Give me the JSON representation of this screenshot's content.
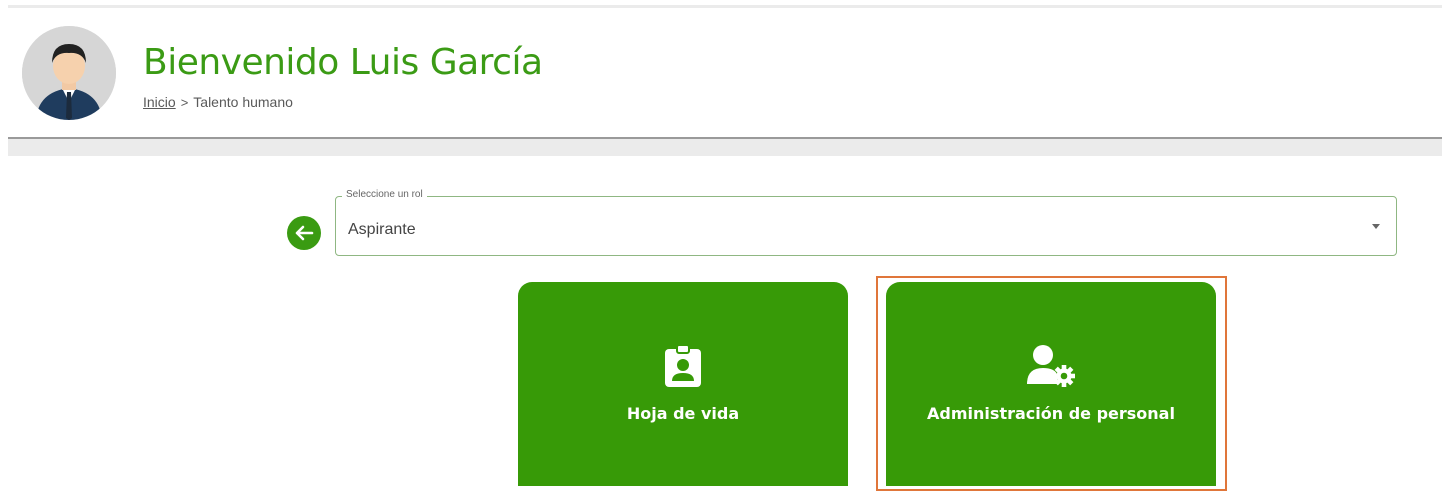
{
  "header": {
    "title": "Bienvenido Luis García",
    "breadcrumb": {
      "home": "Inicio",
      "separator": ">",
      "current": "Talento humano"
    }
  },
  "role_select": {
    "legend": "Seleccione un rol",
    "value": "Aspirante"
  },
  "cards": [
    {
      "label": "Hoja de vida",
      "icon": "id-badge-icon"
    },
    {
      "label": "Administración de personal",
      "icon": "user-gear-icon"
    }
  ],
  "colors": {
    "brand_green": "#3a9b12",
    "highlight": "#e0763a",
    "title_green": "#3b9b15"
  }
}
